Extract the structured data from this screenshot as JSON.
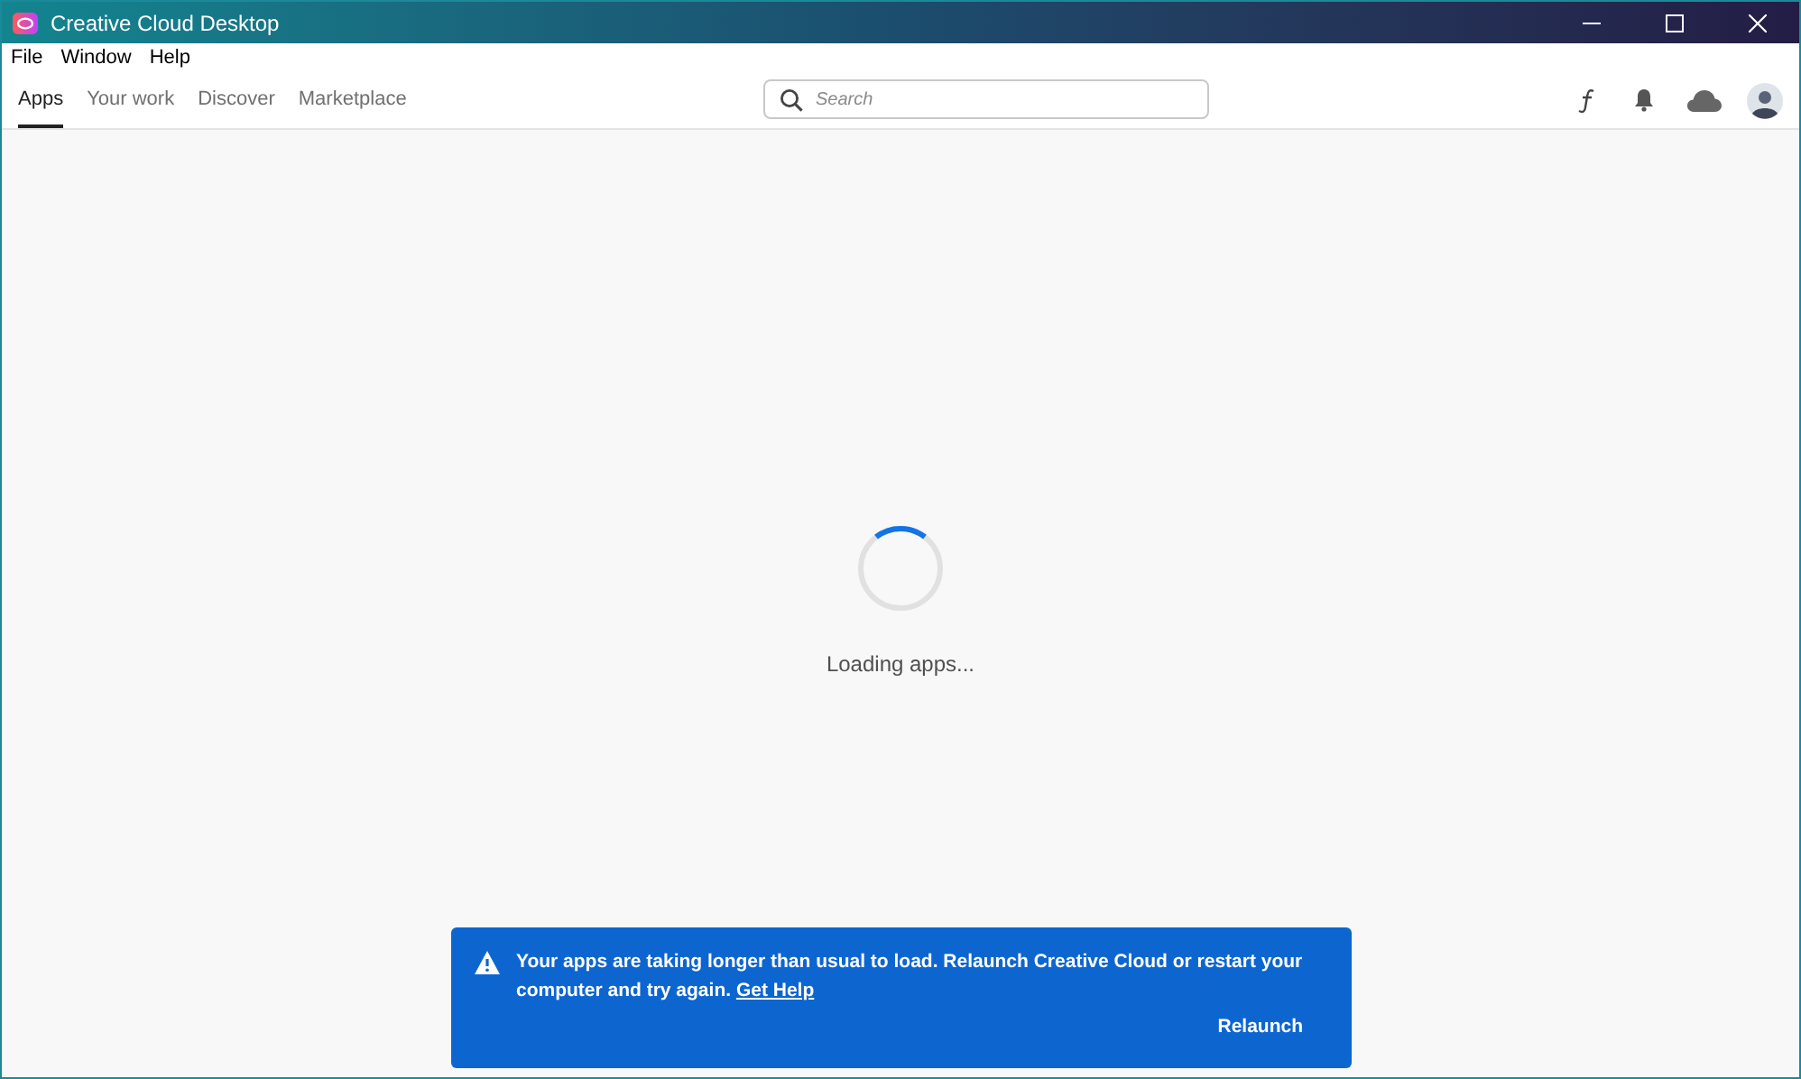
{
  "window": {
    "title": "Creative Cloud Desktop"
  },
  "menu": [
    "File",
    "Window",
    "Help"
  ],
  "tabs": [
    {
      "label": "Apps",
      "selected": true
    },
    {
      "label": "Your work",
      "selected": false
    },
    {
      "label": "Discover",
      "selected": false
    },
    {
      "label": "Marketplace",
      "selected": false
    }
  ],
  "search": {
    "placeholder": "Search"
  },
  "loading": {
    "text": "Loading apps..."
  },
  "toast": {
    "message": "Your apps are taking longer than usual to load. Relaunch Creative Cloud or restart your computer and try again.",
    "link": "Get Help",
    "action": "Relaunch"
  }
}
